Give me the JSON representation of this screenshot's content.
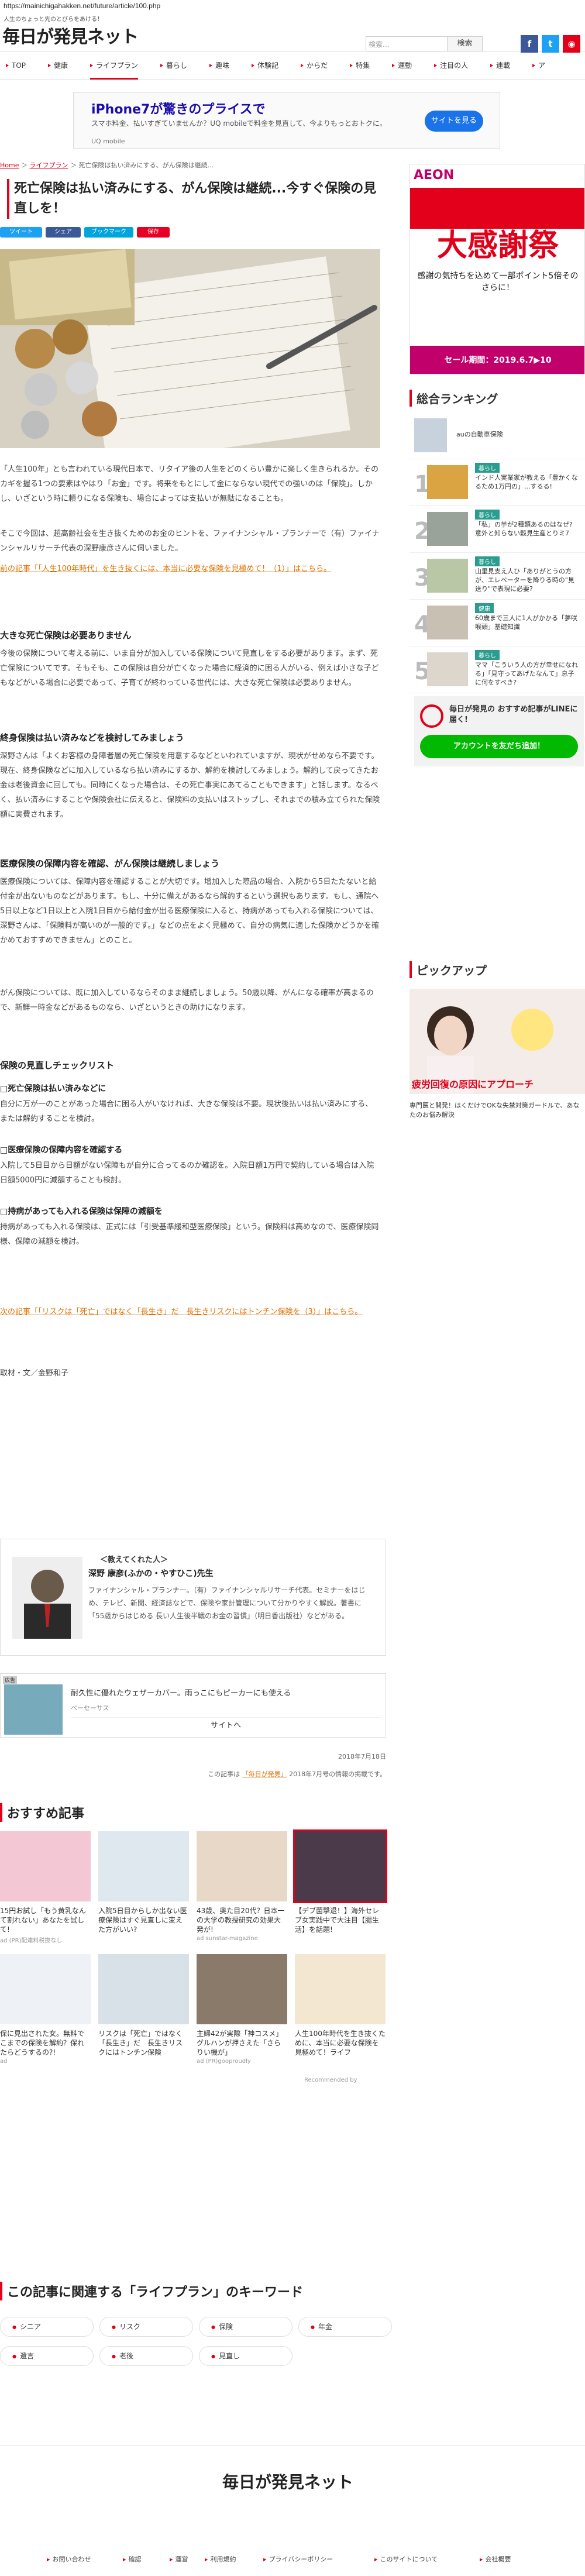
{
  "url": "https://mainichigahakken.net/future/article/100.php",
  "header": {
    "tagline": "人生のちょっと先のとびらをあける！",
    "logo": "毎日が発見ネット",
    "search_placeholder": "検索...",
    "search_button": "検索"
  },
  "nav": [
    "TOP",
    "健康",
    "ライフプラン",
    "暮らし",
    "趣味",
    "体験記",
    "からだ",
    "特集",
    "運動",
    "注目の人",
    "連載",
    "ア"
  ],
  "ad": {
    "title": "iPhone7が驚きのプライスで",
    "body": "スマホ料金、払いすぎていませんか？UQ mobileで料金を見直して、今よりもっとおトクに。",
    "sponsor": "UQ mobile",
    "button": "サイトを見る"
  },
  "breadcrumb": {
    "home": "Home",
    "sep1": " ＞ ",
    "cat": "ライフプラン",
    "sep2": " ＞ ",
    "page": "死亡保険は払い済みにする、がん保険は継続..."
  },
  "title": "死亡保険は払い済みにする、がん保険は継続...今すぐ保険の見直しを！",
  "share": [
    "ツイート",
    "シェア",
    "ブックマーク",
    "保存"
  ],
  "body": {
    "p1": "「人生100年」とも言われている現代日本で、リタイア後の人生をどのくらい豊かに楽しく生きられるか。そのカギを握る1つの要素はやはり「お金」です。将来をもとにして金にならない現代での強いのは「保険」。しかし、いざという時に頼りになる保険も、場合によっては支払いが無駄になることも。",
    "p2": "そこで今回は、超高齢社会を生き抜くためのお金のヒントを、ファイナンシャル・プランナーで（有）ファイナンシャルリサーチ代表の深野康彦さんに伺いました。",
    "link1": "前の記事「「人生100年時代」を生き抜くには、本当に必要な保険を見極めて！（1）」はこちら。",
    "h_1": "大きな死亡保険は必要ありません",
    "p3": "今後の保険について考える前に、いま自分が加入している保険について見直しをする必要があります。まず、死亡保険についてです。そもそも、この保険は自分が亡くなった場合に経済的に困る人がいる、例えば小さな子どもなどがいる場合に必要であって、子育てが終わっている世代には、大きな死亡保険は必要ありません。",
    "h_2": "終身保険は払い済みなどを検討してみましょう",
    "p4": "深野さんは「よくお客様の身障者層の死亡保険を用意するなどといわれていますが、現状がせめなら不要です。現在、終身保険などに加入しているなら払い済みにするか、解約を検討してみましょう。解約して戻ってきたお金は老後資金に回しても。同時にくなった場合は、その死亡事実にあてることもできます」と話します。なるべく、払い済みにすることや保険会社に伝えると、保険料の支払いはストップし、それまでの積み立てられた保険額に実費されます。",
    "h_3": "医療保険の保障内容を確認、がん保険は継続しましょう",
    "p5": "医療保険については、保障内容を確認することが大切です。增加入した際品の場合、入院から5日たたないと給付金が出ないものなどがあります。もし、十分に備えがあるなら解約するという選択もあります。もし、通院へ5日以上など1日以上と入院1日目から給付金が出る医療保険に入ると、持病があっても入れる保険については、深野さんは、「保険料が高いのが一般的です。」などの点をよく見極めて、自分の病気に適した保険かどうかを確かめておすすめできません」とのこと。",
    "p6": "がん保険については、既に加入しているならそのまま継続しましょう。50歳以降、がんになる確率が高まるので、新鮮一時金などがあるものなら、いざというときの助けになります。",
    "h_4": "保険の見直しチェックリスト",
    "c1": "□死亡保険は払い済みなどに",
    "c1t": "自分に万が一のことがあった場合に困る人がいなければ、大きな保険は不要。現状後払いは払い済みにする、または解約することを検討。",
    "c2": "□医療保険の保障内容を確認する",
    "c2t": "入院して5日目から日額がない保障もが自分に合ってるのか確認を。入院日額1万円で契約している場合は入院日額5000円に減額することも検討。",
    "c3": "□持病があっても入れる保険は保障の減額を",
    "c3t": "持病があっても入れる保険は、正式には「引受基準緩和型医療保険」という。保険料は高めなので、医療保険同様、保障の減額を検討。",
    "link2": "次の記事「「リスクは「死亡」ではなく「長生き」だ　長生きリスクにはトンチン保険を（3）」はこちら。",
    "credit": "取材・文／金野和子"
  },
  "author": {
    "label": "＜教えてくれた人＞",
    "name": "深野 康彦(ふかの・やすひこ)先生",
    "bio": "ファイナンシャル・プランナー。（有）ファイナンシャルリサーチ代表。セミナーをはじめ、テレビ、新聞、経済誌などで、保険や家計管理について分かりやすく解説。著書に「55歳からはじめる 長い人生後半戦のお金の習慣」（明日香出版社）などがある。"
  },
  "ad2": {
    "tag": "広告",
    "title": "耐久性に優れたウェザーカバー。雨っこにもピーカーにも使える",
    "sponsor": "ベーセーサス",
    "button": "サイトへ"
  },
  "date": "2018年7月18日",
  "source_note": {
    "pre": "この記事は ",
    "link": "「毎日が発見」",
    "post": " 2018年7月号の情報の掲載です。"
  },
  "sidebar": {
    "ad_brand": "AEON",
    "ad_title": "大感謝祭",
    "ad_sub": "感謝の気持ちを込めて一部ポイント5倍そのさらに！",
    "ad_date": "セール期間：2019.6.7▶10",
    "ranking_title": "総合ランキング",
    "ranking": [
      {
        "num": "",
        "tag": "",
        "text": "auの自動車保険"
      },
      {
        "num": "1",
        "tag": "暮らし",
        "text": "インド人実業家が教える「豊かくなるため1万円の」...するる!"
      },
      {
        "num": "2",
        "tag": "暮らし",
        "text": "「私」の芋が2種類あるのはなぜ? 意外と知らない穀見生産とりミ7"
      },
      {
        "num": "3",
        "tag": "暮らし",
        "text": "山里見支え人ひ「ありがとうの方が、エレベーターを降りる時の\"見送り\"で表現に必要?"
      },
      {
        "num": "4",
        "tag": "健康",
        "text": "60歳まで三人に1人がかかる「夢咲喉頭」基礎知識"
      },
      {
        "num": "5",
        "tag": "暮らし",
        "text": "ママ「こういう人の方が幸せになれる」「見守ってあげたなんて」息子に何をすべき?"
      }
    ],
    "line_title": "毎日が発見の おすすめ記事がLINEに届く!",
    "line_button": "アカウントを友だち追加！",
    "pickup_title": "ピックアップ",
    "pickup_caption": "疲労回復の原因にアプローチ",
    "pickup_text": "専門医と開発！はくだけでOKな失禁対策ガードルで、あなたのお悩み解決"
  },
  "rec": {
    "title": "おすすめ記事",
    "items": [
      {
        "text": "15円お試し「もう黄乳なんて割れない」あなたを試して!",
        "src": "ad (PR)配達料税抜なし"
      },
      {
        "text": "入院5日目からしか出ない医療保険はすぐ見直しに変えた方がいい?",
        "src": ""
      },
      {
        "text": "43歳、奥た目20代？日本一の大学の教授研究の効果大発が!",
        "src": "ad sunstar-magazine"
      },
      {
        "text": "【デブ菌撃退！】海外セレブ女実践中で大注目【腸生活】を話題!",
        "src": ""
      },
      {
        "text": "保に見出された女。無料でこまでの保険を解約？保れたらどうするの?!",
        "src": "ad"
      },
      {
        "text": "リスクは「死亡」ではなく「長生き」だ　長生きリスクにはトンチン保険",
        "src": ""
      },
      {
        "text": "主婦42が実際「神コスメ」グルハンが押さえた「さらりい機が」",
        "src": "ad (PR)gooproudly"
      },
      {
        "text": "人生100年時代を生き抜くために、本当に必要な保険を見極めて！ライフ",
        "src": ""
      }
    ],
    "credit": "Recommended by"
  },
  "keywords": {
    "title": "この記事に関連する「ライフプラン」のキーワード",
    "items": [
      "シニア",
      "リスク",
      "保険",
      "年金",
      "遺言",
      "老後",
      "見直し"
    ]
  },
  "footer": {
    "logo": "毎日が発見ネット",
    "links": [
      "お問い合わせ",
      "確認",
      "運営",
      "利用規約",
      "プライバシーポリシー",
      "このサイトについて",
      "会社概要"
    ]
  },
  "colors": {
    "accent": "#e2001a",
    "twitter": "#1da1f2",
    "facebook": "#3b5998",
    "line": "#00b900"
  }
}
